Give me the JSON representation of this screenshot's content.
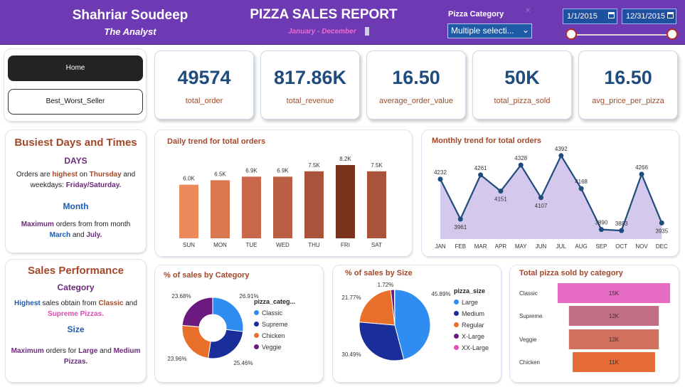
{
  "header": {
    "name": "Shahriar Soudeep",
    "role": "The Analyst",
    "title": "PIZZA SALES REPORT",
    "subtitle": "January - December",
    "category_label": "Pizza Category",
    "category_value": "Multiple selecti...",
    "date_start": "1/1/2015",
    "date_end": "12/31/2015"
  },
  "nav": {
    "home": "Home",
    "best_worst": "Best_Worst_Seller"
  },
  "kpis": [
    {
      "value": "49574",
      "label": "total_order"
    },
    {
      "value": "817.86K",
      "label": "total_revenue"
    },
    {
      "value": "16.50",
      "label": "average_order_value"
    },
    {
      "value": "50K",
      "label": "total_pizza_sold"
    },
    {
      "value": "16.50",
      "label": "avg_price_per_pizza"
    }
  ],
  "busiest": {
    "title": "Busiest Days and Times",
    "days_heading": "DAYS",
    "days_t1": "Orders are ",
    "days_t2": "highest",
    "days_t3": " on ",
    "days_t4": "Thursday",
    "days_t5": " and weekdays: ",
    "days_t6": "Friday/Saturday.",
    "month_heading": "Month",
    "month_t1": "Maximum",
    "month_t2": " orders from from month ",
    "month_t3": "March",
    "month_t4": " and ",
    "month_t5": "July."
  },
  "sales_perf": {
    "title": "Sales Performance",
    "cat_heading": "Category",
    "cat_t1": "Highest",
    "cat_t2": " sales obtain from ",
    "cat_t3": "Classic",
    "cat_t4": " and ",
    "cat_t5": "Supreme Pizzas.",
    "size_heading": "Size",
    "size_t1": "Maximum",
    "size_t2": " orders for ",
    "size_t3": "Large",
    "size_t4": " and ",
    "size_t5": "Medium Pizzas."
  },
  "colors": {
    "header": "#6d3ab3",
    "kpi_value": "#1f4c7c",
    "accent": "#a3482a",
    "area": "#d4c8ec",
    "line": "#1f4c7c"
  },
  "chart_data": [
    {
      "type": "bar",
      "title": "Daily trend for total orders",
      "categories": [
        "SUN",
        "MON",
        "TUE",
        "WED",
        "THU",
        "FRI",
        "SAT"
      ],
      "values": [
        6.0,
        6.5,
        6.9,
        6.9,
        7.5,
        8.2,
        7.5
      ],
      "value_labels": [
        "6.0K",
        "6.5K",
        "6.9K",
        "6.9K",
        "7.5K",
        "8.2K",
        "7.5K"
      ],
      "colors": [
        "#ed8a5c",
        "#d9774f",
        "#c9684a",
        "#bb5f44",
        "#a9533a",
        "#7a321c",
        "#a9533a"
      ],
      "ylim": [
        0,
        8.6
      ]
    },
    {
      "type": "area",
      "title": "Monthly trend for total orders",
      "categories": [
        "JAN",
        "FEB",
        "MAR",
        "APR",
        "MAY",
        "JUN",
        "JUL",
        "AUG",
        "SEP",
        "OCT",
        "NOV",
        "DEC"
      ],
      "values": [
        4232,
        3961,
        4261,
        4151,
        4328,
        4107,
        4392,
        4168,
        3890,
        3883,
        4266,
        3935
      ],
      "value_labels": [
        "4232",
        "3961",
        "4261",
        "4151",
        "4328",
        "4107",
        "4392",
        "4168",
        "3890",
        "3883",
        "4266",
        "3935"
      ],
      "ylim": [
        3840,
        4420
      ]
    },
    {
      "type": "pie",
      "title": "% of sales by Category",
      "legend_title": "pizza_categ...",
      "labels": [
        "Classic",
        "Supreme",
        "Chicken",
        "Veggie"
      ],
      "values": [
        26.91,
        25.46,
        23.96,
        23.68
      ],
      "value_labels": [
        "26.91%",
        "25.46%",
        "23.96%",
        "23.68%"
      ],
      "colors": [
        "#2f8cf0",
        "#1a2e9a",
        "#e8702a",
        "#6b1b7f"
      ]
    },
    {
      "type": "pie",
      "title": "% of sales by Size",
      "legend_title": "pizza_size",
      "labels": [
        "Large",
        "Medium",
        "Regular",
        "X-Large",
        "XX-Large"
      ],
      "values": [
        45.89,
        30.49,
        21.77,
        1.72,
        0.12
      ],
      "value_labels": [
        "45.89%",
        "30.49%",
        "21.77%",
        "1.72%",
        ""
      ],
      "colors": [
        "#2f8cf0",
        "#1a2e9a",
        "#e8702a",
        "#6b1b7f",
        "#e052b8"
      ]
    },
    {
      "type": "bar",
      "title": "Total pizza sold by category",
      "categories": [
        "Classic",
        "Supreme",
        "Veggie",
        "Chicken"
      ],
      "values": [
        15,
        12,
        12,
        11
      ],
      "value_labels": [
        "15K",
        "12K",
        "12K",
        "11K"
      ],
      "colors": [
        "#e66bc2",
        "#c26e86",
        "#d27060",
        "#e66c36"
      ],
      "xlim": [
        0,
        15
      ]
    }
  ]
}
